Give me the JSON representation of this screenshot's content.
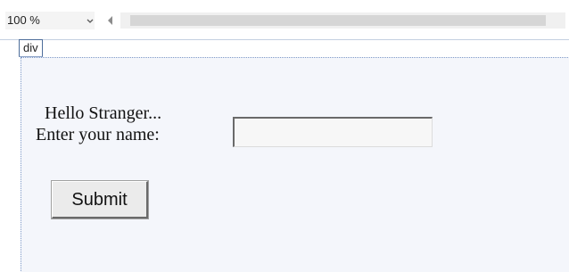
{
  "toolbar": {
    "zoom_value": "100 %",
    "zoom_dropdown_icon": "chevron-down-icon",
    "scroll_left_icon": "triangle-left-icon"
  },
  "designer": {
    "element_tag": "div",
    "greeting": "Hello Stranger...",
    "name_label": "Enter your name:",
    "name_input_value": "",
    "submit_label": "Submit"
  },
  "colors": {
    "div_outline": "#7f9ac8",
    "div_fill": "#f4f6fb",
    "button_face": "#ebebeb"
  }
}
